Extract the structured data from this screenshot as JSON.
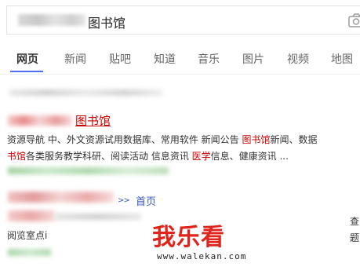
{
  "search": {
    "query_suffix": "图书馆",
    "camera_icon": "camera-icon"
  },
  "tabs": [
    {
      "label": "网页",
      "active": true
    },
    {
      "label": "新闻",
      "active": false
    },
    {
      "label": "贴吧",
      "active": false
    },
    {
      "label": "知道",
      "active": false
    },
    {
      "label": "音乐",
      "active": false
    },
    {
      "label": "图片",
      "active": false
    },
    {
      "label": "视频",
      "active": false
    },
    {
      "label": "地图",
      "active": false
    }
  ],
  "results": [
    {
      "title_suffix": "图书馆",
      "snippet_line1": {
        "a": "资源导航 中、外文资源试用数据库、常用软件 新闻公告 ",
        "hl1": "图书馆",
        "b": "新闻、数据"
      },
      "snippet_line2": {
        "hl1": "书馆",
        "a": "各类服务教学科研、阅读活动 信息资讯 ",
        "hl2": "医学",
        "b": "信息、健康资讯 ..."
      }
    },
    {
      "title_suffix": "首页",
      "snippet": "阅览室点i",
      "right_chars": [
        "查",
        "题"
      ]
    }
  ],
  "watermark": {
    "logo": "我乐看",
    "url": "www.walekan.com"
  },
  "colors": {
    "highlight": "#c00000",
    "link": "#3b57c4",
    "tab_underline": "#4e6ef2",
    "watermark": "#e0231b"
  }
}
